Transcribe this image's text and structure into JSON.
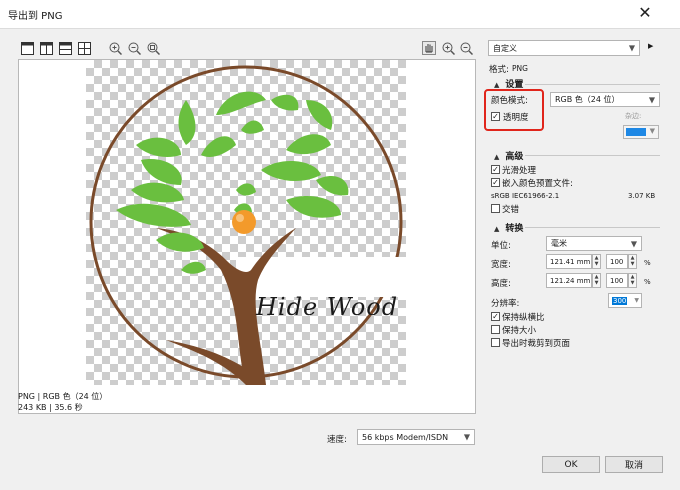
{
  "window": {
    "title": "导出到 PNG",
    "close": "✕"
  },
  "preview": {
    "logo_text": "Hide Wood"
  },
  "info": {
    "line1": "PNG | RGB 色（24 位）",
    "line2": "243 KB | 35.6 秒"
  },
  "speed": {
    "label": "速度:",
    "value": "56 kbps Modem/ISDN"
  },
  "preset": {
    "value": "自定义"
  },
  "format": {
    "label": "格式:",
    "value": "PNG"
  },
  "settings": {
    "heading": "设置",
    "color_mode_label": "颜色模式:",
    "color_mode_value": "RGB 色（24 位）",
    "transparency_label": "透明度",
    "transparency_checked": true,
    "matte_label": "杂边:",
    "matte_color": "#1e88e5"
  },
  "advanced": {
    "heading": "高级",
    "antialias_label": "光滑处理",
    "antialias_checked": true,
    "embed_label": "嵌入颜色预置文件:",
    "embed_checked": true,
    "profile": "sRGB IEC61966-2.1",
    "profile_size": "3.07 KB",
    "interlace_label": "交错",
    "interlace_checked": false
  },
  "transform": {
    "heading": "转换",
    "unit_label": "单位:",
    "unit_value": "毫米",
    "width_label": "宽度:",
    "width_value": "121.41 mm",
    "width_pct": "100",
    "height_label": "高度:",
    "height_value": "121.24 mm",
    "height_pct": "100",
    "pct_sign": "%",
    "resolution_label": "分辨率:",
    "resolution_value": "300",
    "keep_ratio_label": "保持纵横比",
    "keep_ratio_checked": true,
    "keep_size_label": "保持大小",
    "keep_size_checked": false,
    "crop_label": "导出时裁剪到页面",
    "crop_checked": false
  },
  "buttons": {
    "ok": "OK",
    "cancel": "取消"
  },
  "colors": {
    "accent_red": "#e0251b",
    "leaf_green": "#6abf3f",
    "trunk_brown": "#7a4a2a",
    "orange": "#f39a2b"
  },
  "icons": [
    "layout-single-icon",
    "layout-split-vertical-icon",
    "layout-split-horizontal-icon",
    "layout-quad-icon",
    "zoom-in-icon",
    "zoom-out-icon",
    "zoom-fit-icon",
    "hand-pan-icon",
    "zoom-in-icon",
    "zoom-out-icon"
  ]
}
